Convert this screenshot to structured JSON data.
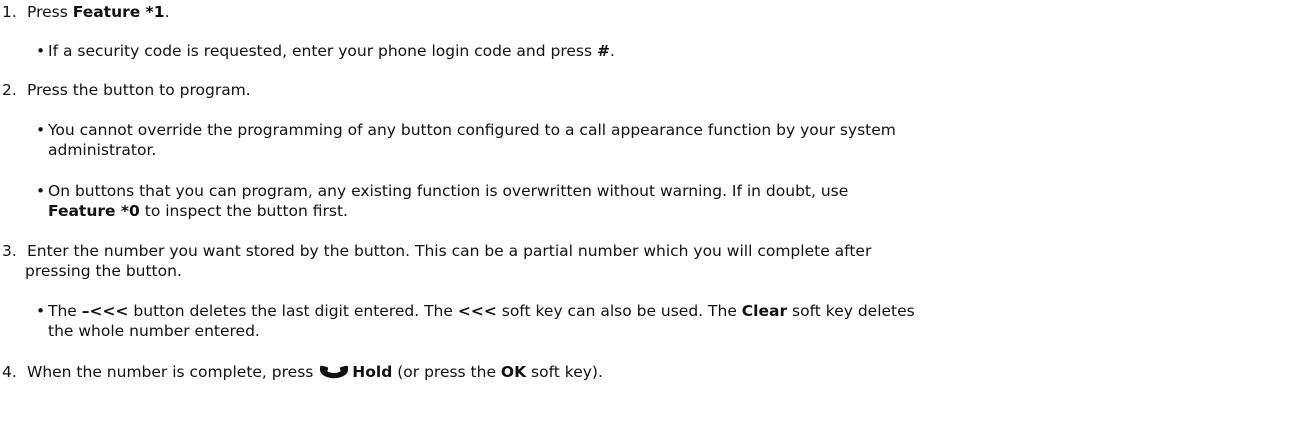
{
  "steps": [
    {
      "number": "1.",
      "parts": [
        "Press ",
        "Feature *1",
        "."
      ],
      "bullets": [
        {
          "parts": [
            "If a security code is requested, enter your phone login code and press ",
            "#",
            "."
          ]
        }
      ]
    },
    {
      "number": "2.",
      "text": "Press the button to program.",
      "bullets": [
        {
          "line1": "You cannot override the programming of any button configured to a call appearance function by your system",
          "line2": "administrator."
        },
        {
          "line1": "On buttons that you can program, any existing function is overwritten without warning. If in doubt, use",
          "line2_parts": [
            "Feature *0",
            " to inspect the button first."
          ]
        }
      ]
    },
    {
      "number": "3.",
      "line1": "Enter the number you want stored by the button. This can be a partial number which you will complete after",
      "line2": "pressing the button.",
      "bullets": [
        {
          "line1_parts": [
            "The ",
            "–<<<",
            " button deletes the last digit entered. The ",
            "<<<",
            " soft key can also be used. The ",
            "Clear",
            " soft key deletes"
          ],
          "line2": "the whole number entered."
        }
      ]
    },
    {
      "number": "4.",
      "parts": [
        "When the number is complete, press ",
        "Hold",
        " (or press the ",
        "OK",
        " soft key)."
      ],
      "icon": "handset-icon"
    }
  ],
  "bullet_glyph": "•"
}
